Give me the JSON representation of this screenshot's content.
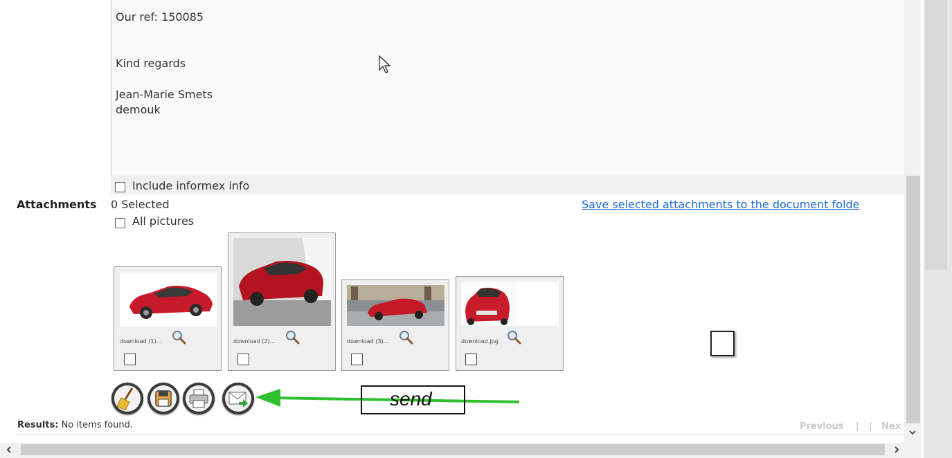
{
  "email": {
    "lines": [
      "Our ref: 150085",
      "Kind regards",
      "Jean-Marie Smets",
      "demouk"
    ]
  },
  "include_informex": {
    "label": "Include informex info"
  },
  "attachments": {
    "section_label": "Attachments",
    "selected_count": "0 Selected",
    "all_pictures_label": "All pictures",
    "save_link": "Save selected attachments to the document folde",
    "files": [
      {
        "name": "download (1)...",
        "color": "#c8192a"
      },
      {
        "name": "download (2)...",
        "color": "#b3121f"
      },
      {
        "name": "download (3)...",
        "color": "#c41a28"
      },
      {
        "name": "download.jpg",
        "color": "#c81c2a"
      }
    ]
  },
  "toolbar": {
    "buttons": [
      "broom-icon",
      "save-icon",
      "print-icon",
      "send-mail-icon"
    ]
  },
  "annotation": {
    "text": "send",
    "arrow_color": "#2fbf2f"
  },
  "results": {
    "label": "Results:",
    "text": "No items found."
  },
  "pager": {
    "previous": "Previous",
    "separator": "|",
    "next": "Nex"
  }
}
